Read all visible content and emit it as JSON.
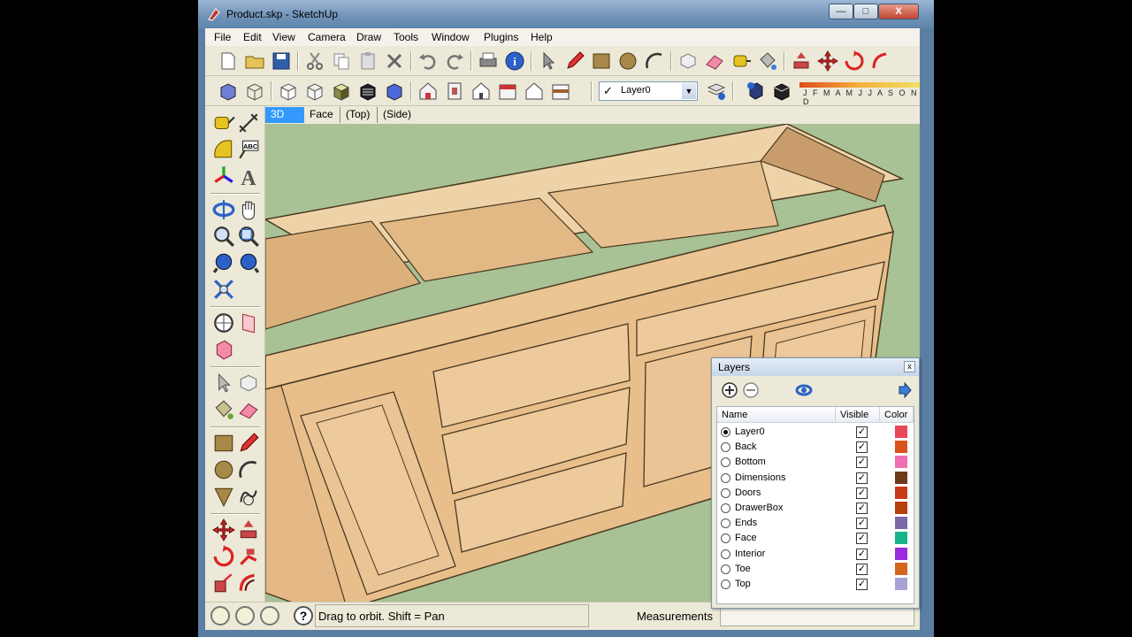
{
  "window": {
    "title": "Product.skp - SketchUp",
    "minimize": "—",
    "maximize": "□",
    "close": "X"
  },
  "menu": [
    "File",
    "Edit",
    "View",
    "Camera",
    "Draw",
    "Tools",
    "Window",
    "Plugins",
    "Help"
  ],
  "toolbar": {
    "layer_check": "✓",
    "layer_selected": "Layer0",
    "layer_dropdown_arrow": "▼",
    "shadow_months": "J F M A M J J A S O N D"
  },
  "scene_tabs": [
    "3D",
    "Face",
    "(Top)",
    "(Side)"
  ],
  "status": {
    "help": "?",
    "text": "Drag to orbit.  Shift = Pan",
    "measurements_label": "Measurements",
    "measurements_value": ""
  },
  "layers_panel": {
    "title": "Layers",
    "close": "x",
    "headers": {
      "name": "Name",
      "visible": "Visible",
      "color": "Color"
    },
    "layers": [
      {
        "name": "Layer0",
        "active": true,
        "visible": "✓",
        "color": "#e8475a"
      },
      {
        "name": "Back",
        "active": false,
        "visible": "✓",
        "color": "#d9531e"
      },
      {
        "name": "Bottom",
        "active": false,
        "visible": "✓",
        "color": "#ee6fb0"
      },
      {
        "name": "Dimensions",
        "active": false,
        "visible": "✓",
        "color": "#6b3b1c"
      },
      {
        "name": "Doors",
        "active": false,
        "visible": "✓",
        "color": "#c93a18"
      },
      {
        "name": "DrawerBox",
        "active": false,
        "visible": "✓",
        "color": "#b6410f"
      },
      {
        "name": "Ends",
        "active": false,
        "visible": "✓",
        "color": "#7c6aa8"
      },
      {
        "name": "Face",
        "active": false,
        "visible": "✓",
        "color": "#17b38a"
      },
      {
        "name": "Interior",
        "active": false,
        "visible": "✓",
        "color": "#9a2de0"
      },
      {
        "name": "Toe",
        "active": false,
        "visible": "✓",
        "color": "#d4651c"
      },
      {
        "name": "Top",
        "active": false,
        "visible": "✓",
        "color": "#a7a3d6"
      }
    ]
  },
  "colors": {
    "ground": "#a8c195",
    "sky": "#dfe6ee",
    "wood": "#e9c08c",
    "accent_tab": "#3399ff"
  }
}
